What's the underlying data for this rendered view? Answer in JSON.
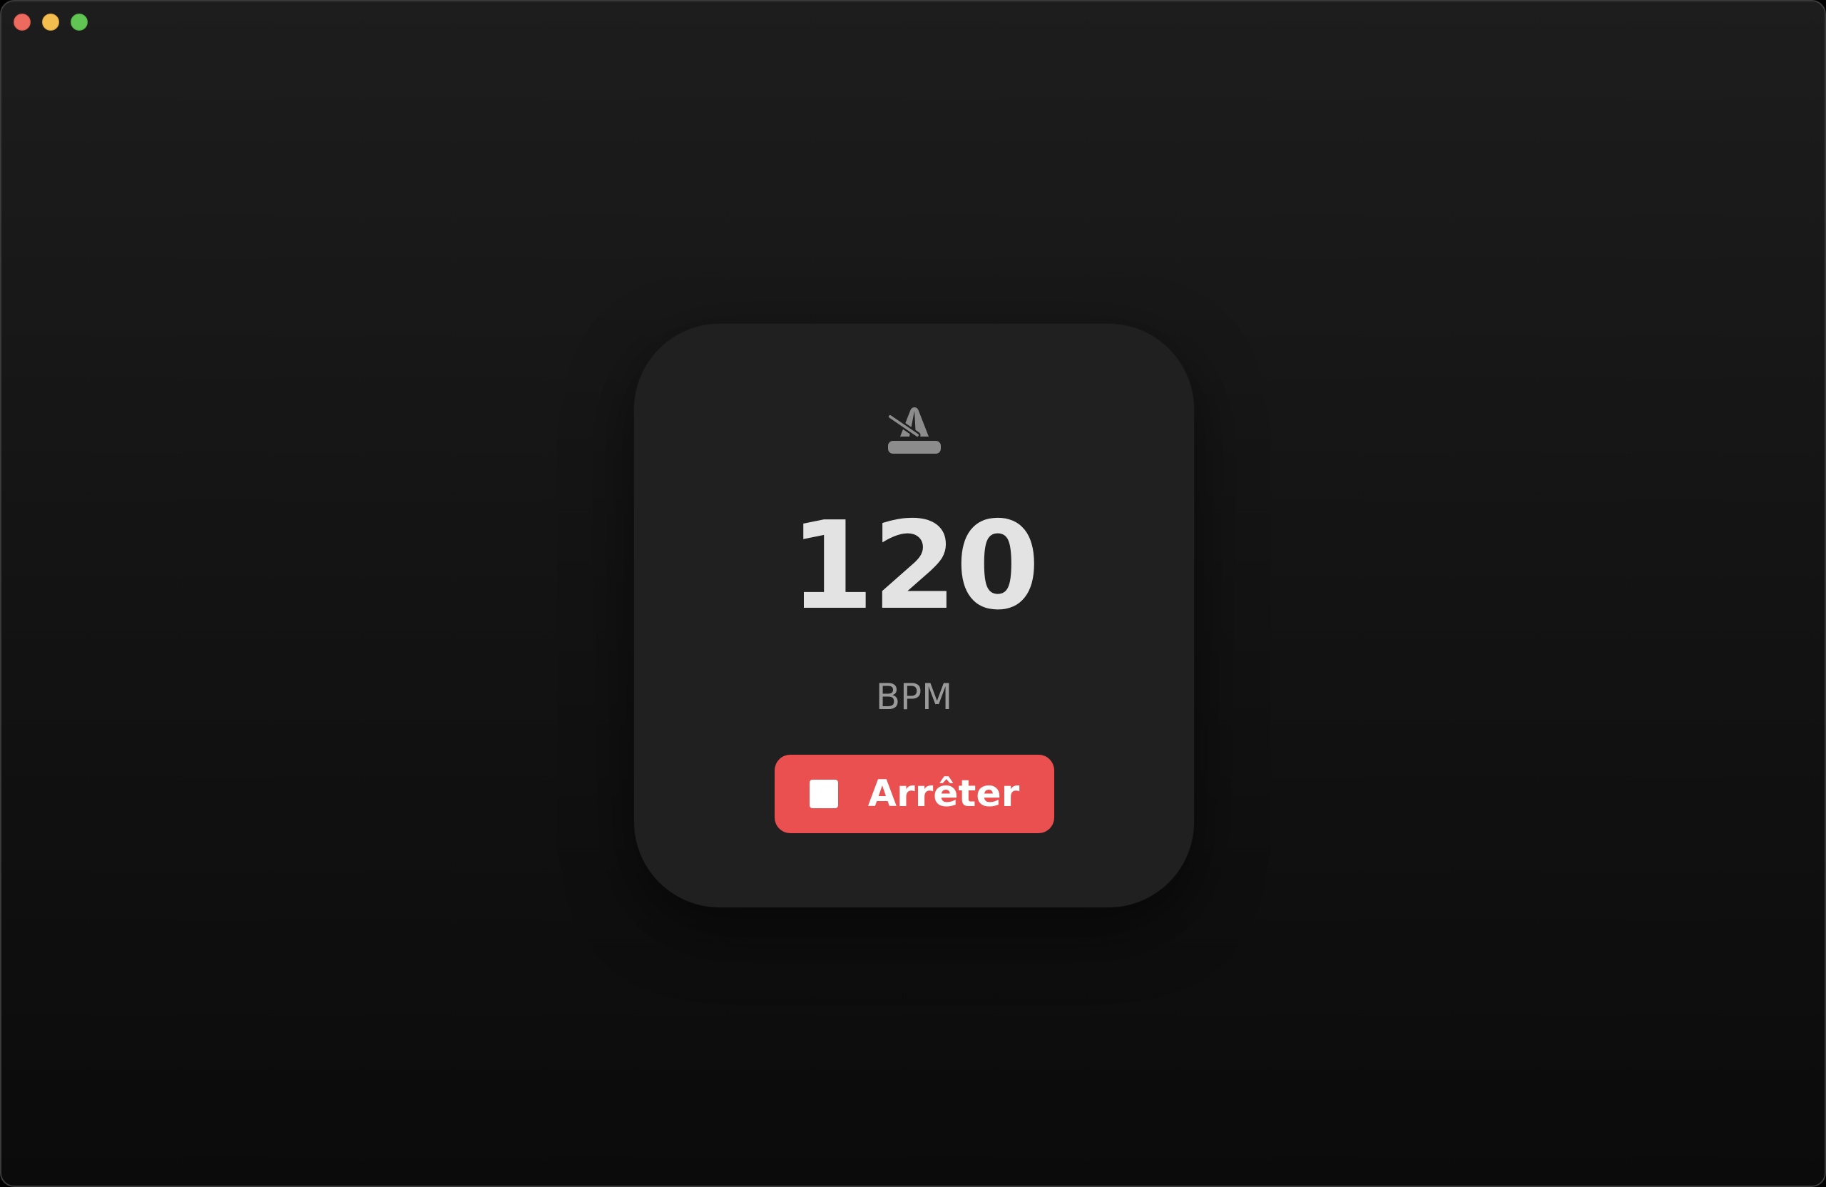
{
  "window": {
    "controls": [
      "close",
      "minimize",
      "zoom"
    ]
  },
  "metronome": {
    "icon": "metronome-icon",
    "bpm_value": "120",
    "bpm_unit": "BPM",
    "stop_button": {
      "label": "Arrêter",
      "icon": "stop-icon",
      "color": "#e9504f"
    }
  },
  "colors": {
    "window_background": "#161616",
    "card_background": "#202021",
    "value_text": "#e3e3e3",
    "unit_text": "#9a9a9a",
    "accent_red": "#e9504f"
  }
}
